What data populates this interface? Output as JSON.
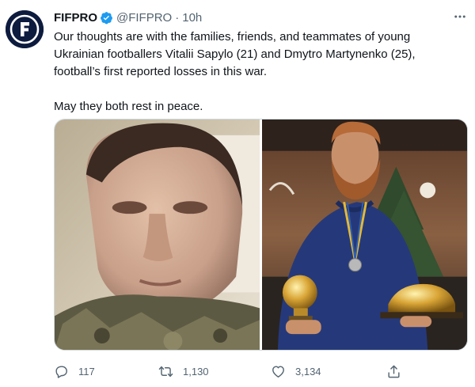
{
  "author": {
    "name": "FIFPRO",
    "handle": "@FIFPRO",
    "separator": "·",
    "time": "10h",
    "brand_color": "#0d1b3e",
    "verified_color": "#1d9bf0"
  },
  "tweet": {
    "lines": [
      "Our thoughts are with the families, friends, and teammates of young",
      "Ukrainian footballers Vitalii Sapylo (21) and Dmytro Martynenko (25),",
      "football’s first reported losses in this war."
    ],
    "closing": "May they both rest in peace."
  },
  "media": {
    "photos": [
      "photo-young-man-selfie",
      "photo-bearded-man-with-trophies"
    ]
  },
  "actions": {
    "replies": "117",
    "retweets": "1,130",
    "likes": "3,134"
  },
  "icons": {
    "more": "more-icon",
    "reply": "reply-icon",
    "retweet": "retweet-icon",
    "like": "heart-icon",
    "share": "share-icon",
    "verified": "verified-icon"
  }
}
